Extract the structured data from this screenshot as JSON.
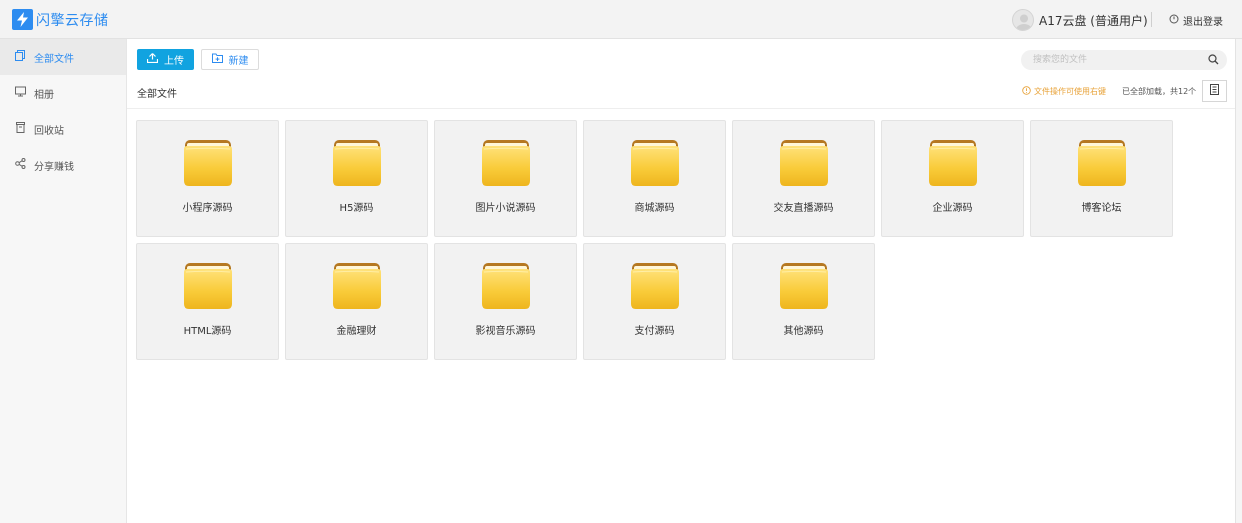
{
  "header": {
    "app_name": "闪擎云存储",
    "logo_icon": "lightning-icon",
    "user_name": "A17云盘 (普通用户)",
    "logout_label": "退出登录",
    "accent": "#2d8cf0"
  },
  "sidebar": {
    "items": [
      {
        "label": "全部文件",
        "icon": "files-icon",
        "active": true
      },
      {
        "label": "相册",
        "icon": "monitor-icon",
        "active": false
      },
      {
        "label": "回收站",
        "icon": "trash-icon",
        "active": false
      },
      {
        "label": "分享赚钱",
        "icon": "share-icon",
        "active": false
      }
    ]
  },
  "toolbar": {
    "upload_label": "上传",
    "new_label": "新建",
    "upload_color": "#11a3e0"
  },
  "search": {
    "placeholder": "搜索您的文件",
    "value": ""
  },
  "breadcrumb": {
    "current": "全部文件"
  },
  "status": {
    "tip": "文件操作可使用右键",
    "loaded": "已全部加载，共12个"
  },
  "files": [
    {
      "name": "小程序源码",
      "type": "folder"
    },
    {
      "name": "H5源码",
      "type": "folder"
    },
    {
      "name": "图片小说源码",
      "type": "folder"
    },
    {
      "name": "商城源码",
      "type": "folder"
    },
    {
      "name": "交友直播源码",
      "type": "folder"
    },
    {
      "name": "企业源码",
      "type": "folder"
    },
    {
      "name": "博客论坛",
      "type": "folder"
    },
    {
      "name": "HTML源码",
      "type": "folder"
    },
    {
      "name": "金融理财",
      "type": "folder"
    },
    {
      "name": "影视音乐源码",
      "type": "folder"
    },
    {
      "name": "支付源码",
      "type": "folder"
    },
    {
      "name": "其他源码",
      "type": "folder"
    }
  ]
}
